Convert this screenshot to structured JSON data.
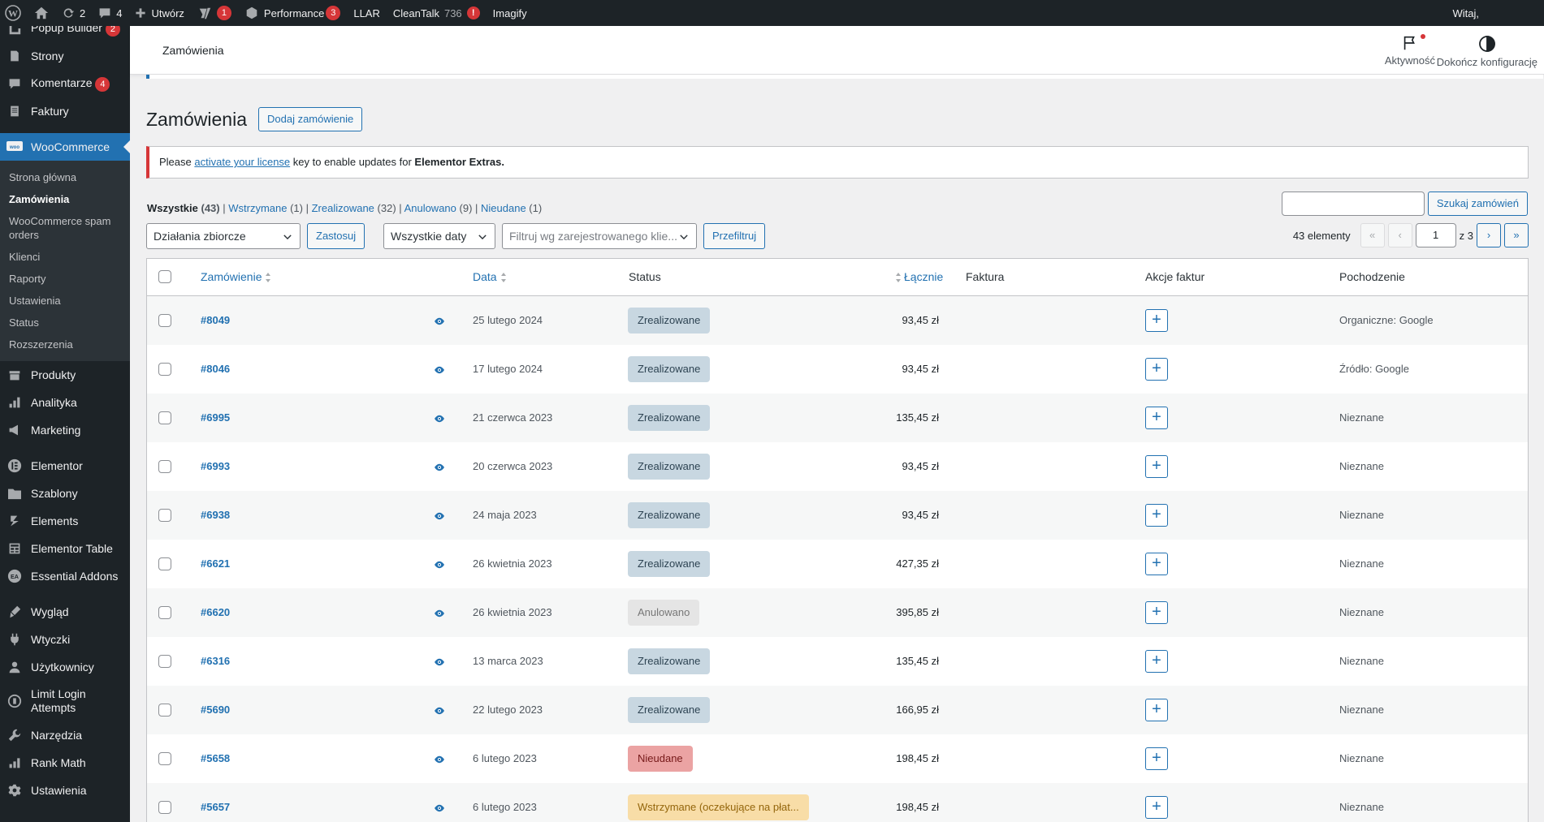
{
  "adminbar": {
    "updates_count": "2",
    "comments_count": "4",
    "new_label": "Utwórz",
    "yoast_count": "1",
    "performance_label": "Performance",
    "performance_count": "3",
    "llar_label": "LLAR",
    "cleantalk_label": "CleanTalk",
    "cleantalk_count": "736",
    "cleantalk_alert": "!",
    "imagify_label": "Imagify",
    "greeting": "Witaj,"
  },
  "sidebar": {
    "items_top": [
      {
        "label": "Popup Builder",
        "count": "2",
        "icon": "popup-icon"
      },
      {
        "label": "Strony",
        "icon": "pages-icon"
      },
      {
        "label": "Komentarze",
        "count": "4",
        "icon": "comments-icon"
      },
      {
        "label": "Faktury",
        "icon": "invoice-icon"
      }
    ],
    "woocommerce": "WooCommerce",
    "woo_sub": [
      "Strona główna",
      "Zamówienia",
      "WooCommerce spam orders",
      "Klienci",
      "Raporty",
      "Ustawienia",
      "Status",
      "Rozszerzenia"
    ],
    "items_mid": [
      {
        "label": "Produkty",
        "icon": "products-icon"
      },
      {
        "label": "Analityka",
        "icon": "analytics-icon"
      },
      {
        "label": "Marketing",
        "icon": "marketing-icon"
      }
    ],
    "items_elementor": [
      {
        "label": "Elementor",
        "icon": "elementor-icon"
      },
      {
        "label": "Szablony",
        "icon": "templates-icon"
      },
      {
        "label": "Elements",
        "icon": "elements-icon"
      },
      {
        "label": "Elementor Table",
        "icon": "table-icon"
      },
      {
        "label": "Essential Addons",
        "icon": "ea-icon"
      }
    ],
    "items_bottom": [
      {
        "label": "Wygląd",
        "icon": "appearance-icon"
      },
      {
        "label": "Wtyczki",
        "icon": "plugins-icon"
      },
      {
        "label": "Użytkownicy",
        "icon": "users-icon"
      },
      {
        "label": "Limit Login Attempts",
        "icon": "limit-login-icon"
      },
      {
        "label": "Narzędzia",
        "icon": "tools-icon"
      },
      {
        "label": "Rank Math",
        "icon": "rankmath-icon"
      },
      {
        "label": "Ustawienia",
        "icon": "settings-icon"
      }
    ]
  },
  "header": {
    "title": "Zamówienia",
    "activity": "Aktywność",
    "finish_setup": "Dokończ konfigurację"
  },
  "page": {
    "title": "Zamówienia",
    "add_order": "Dodaj zamówienie"
  },
  "notice": {
    "prefix": "Please",
    "link": "activate your license",
    "middle": "key to enable updates for",
    "product": "Elementor Extras."
  },
  "views": [
    {
      "label": "Wszystkie",
      "count": "(43)"
    },
    {
      "label": "Wstrzymane",
      "count": "(1)"
    },
    {
      "label": "Zrealizowane",
      "count": "(32)"
    },
    {
      "label": "Anulowano",
      "count": "(9)"
    },
    {
      "label": "Nieudane",
      "count": "(1)"
    }
  ],
  "search": {
    "value": "",
    "button": "Szukaj zamówień"
  },
  "tablenav": {
    "bulk_actions": "Działania zbiorcze",
    "apply": "Zastosuj",
    "dates": "Wszystkie daty",
    "customer_filter_placeholder": "Filtruj wg zarejestrowanego klie...",
    "filter": "Przefiltruj",
    "items_count": "43 elementy",
    "first": "«",
    "prev": "‹",
    "current_page": "1",
    "of_pages": "z 3",
    "next": "›",
    "last": "»"
  },
  "table": {
    "columns": {
      "order": "Zamówienie",
      "date": "Data",
      "status": "Status",
      "total": "Łącznie",
      "invoice": "Faktura",
      "invoice_actions": "Akcje faktur",
      "origin": "Pochodzenie"
    },
    "rows": [
      {
        "number": "#8049",
        "date": "25 lutego 2024",
        "status": "Zrealizowane",
        "status_type": "completed",
        "total": "93,45 zł",
        "origin": "Organiczne: Google"
      },
      {
        "number": "#8046",
        "date": "17 lutego 2024",
        "status": "Zrealizowane",
        "status_type": "completed",
        "total": "93,45 zł",
        "origin": "Źródło: Google"
      },
      {
        "number": "#6995",
        "date": "21 czerwca 2023",
        "status": "Zrealizowane",
        "status_type": "completed",
        "total": "135,45 zł",
        "origin": "Nieznane"
      },
      {
        "number": "#6993",
        "date": "20 czerwca 2023",
        "status": "Zrealizowane",
        "status_type": "completed",
        "total": "93,45 zł",
        "origin": "Nieznane"
      },
      {
        "number": "#6938",
        "date": "24 maja 2023",
        "status": "Zrealizowane",
        "status_type": "completed",
        "total": "93,45 zł",
        "origin": "Nieznane"
      },
      {
        "number": "#6621",
        "date": "26 kwietnia 2023",
        "status": "Zrealizowane",
        "status_type": "completed",
        "total": "427,35 zł",
        "origin": "Nieznane"
      },
      {
        "number": "#6620",
        "date": "26 kwietnia 2023",
        "status": "Anulowano",
        "status_type": "cancelled",
        "total": "395,85 zł",
        "origin": "Nieznane"
      },
      {
        "number": "#6316",
        "date": "13 marca 2023",
        "status": "Zrealizowane",
        "status_type": "completed",
        "total": "135,45 zł",
        "origin": "Nieznane"
      },
      {
        "number": "#5690",
        "date": "22 lutego 2023",
        "status": "Zrealizowane",
        "status_type": "completed",
        "total": "166,95 zł",
        "origin": "Nieznane"
      },
      {
        "number": "#5658",
        "date": "6 lutego 2023",
        "status": "Nieudane",
        "status_type": "failed",
        "total": "198,45 zł",
        "origin": "Nieznane"
      },
      {
        "number": "#5657",
        "date": "6 lutego 2023",
        "status": "Wstrzymane (oczekujące na płat...",
        "status_type": "onhold",
        "total": "198,45 zł",
        "origin": "Nieznane"
      }
    ],
    "add_invoice_symbol": "+"
  },
  "colors": {
    "admin_dark": "#1d2327",
    "accent": "#2271b1",
    "badge_red": "#d63638"
  }
}
